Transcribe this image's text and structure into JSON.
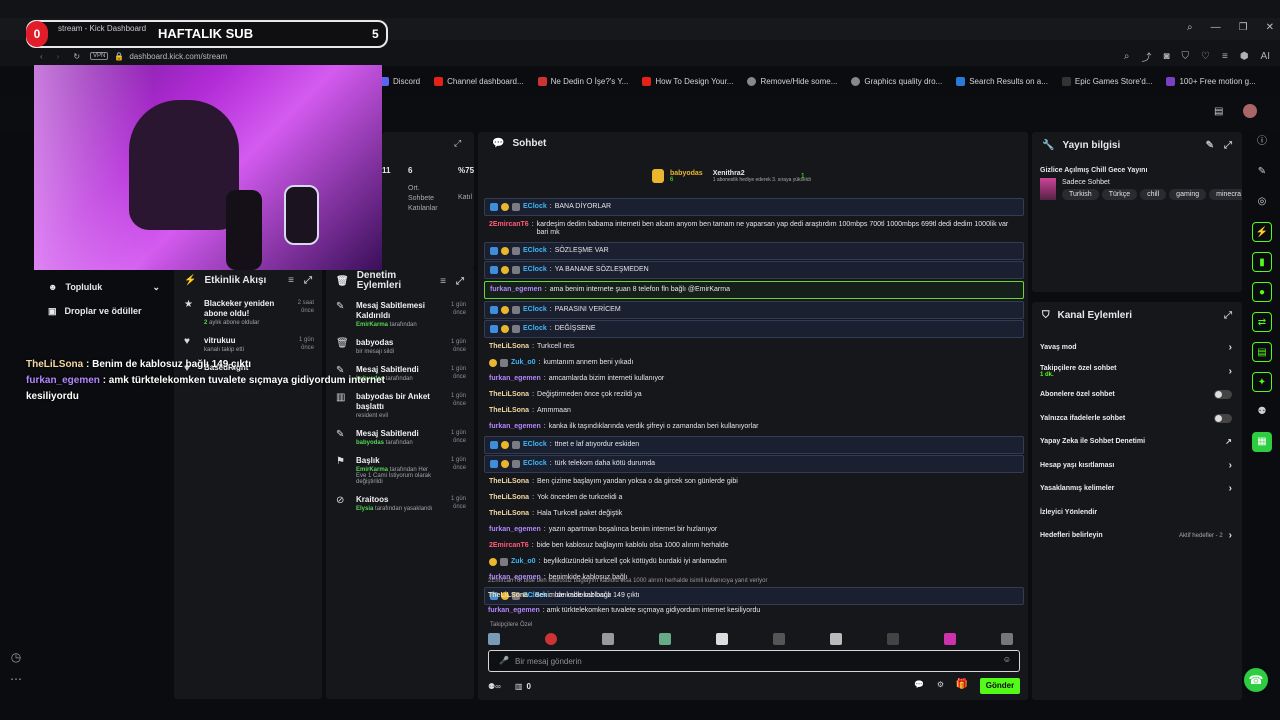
{
  "browser": {
    "tab_title": "stream - Kick Dashboard",
    "url": "dashboard.kick.com/stream",
    "vpn": "VPN",
    "bookmarks": [
      "Discord",
      "Channel dashboard...",
      "Ne Dedin O İşe?'s Y...",
      "How To Design Your...",
      "Remove/Hide some...",
      "Graphics quality dro...",
      "Search Results on a...",
      "Epic Games Store'd...",
      "100+ Free motion g..."
    ],
    "ai_label": "AI"
  },
  "overlay": {
    "sub_count": "0",
    "sub_title": "HAFTALIK SUB",
    "sub_goal": "5",
    "chat": [
      {
        "user": "TheLiLSona",
        "text": " : Benim de kablosuz bağlı 149 çıktı"
      },
      {
        "user": "furkan_egemen",
        "text": " : amk türktelekomken tuvalete sıçmaya gidiyordum internet kesiliyordu"
      }
    ]
  },
  "nav": {
    "items": [
      "Topluluk",
      "Droplar ve ödüller"
    ]
  },
  "stats": {
    "v1": "11",
    "v2": "6",
    "v2_label": "Ort. Sohbete Katılanlar",
    "v3": "%75",
    "v3_label": "Katıl"
  },
  "activity": {
    "title": "Etkinlik Akışı",
    "items": [
      {
        "title": "Blackeker yeniden abone oldu!",
        "sub_b": "2",
        "sub": " aylık abone oldular",
        "time": "2 saat önce",
        "icon": "star"
      },
      {
        "title": "vitrukuu",
        "sub": "kanalı takip etti",
        "time": "1 gün önce",
        "icon": "heart"
      },
      {
        "title": "BasedRight",
        "sub": "",
        "time": "",
        "icon": "heart"
      }
    ]
  },
  "moderation": {
    "title": "Denetim Eylemleri",
    "items": [
      {
        "title": "Mesaj Sabitlemesi Kaldırıldı",
        "sub_b": "EmirKarma",
        "sub": " tarafından",
        "time": "1 gün önce"
      },
      {
        "title": "babyodas",
        "sub": "bir mesajı sildi",
        "time": "1 gün önce"
      },
      {
        "title": "Mesaj Sabitlendi",
        "sub_b": "babyodas",
        "sub": " tarafından",
        "time": "1 gün önce"
      },
      {
        "title": "babyodas bir Anket başlattı",
        "sub": "resident evil",
        "time": "1 gün önce"
      },
      {
        "title": "Mesaj Sabitlendi",
        "sub_b": "babyodas",
        "sub": " tarafından",
        "time": "1 gün önce"
      },
      {
        "title": "Başlık",
        "sub_b": "EmirKarma",
        "sub": " tarafından Her Eve 1 Cami İstiyorum olarak değiştirildi",
        "time": "1 gün önce"
      },
      {
        "title": "Kraitoos",
        "sub_b": "Elysia",
        "sub": " tarafından yasaklandı",
        "time": "1 gün önce"
      }
    ]
  },
  "chat": {
    "title": "Sohbet",
    "pinned": {
      "user1": "babyodas",
      "user1_count": "6",
      "user2": "Xenithra2",
      "user2_count": "1",
      "note": "1 aboneslik hediye ederek 3. sıraya yükseldi"
    },
    "messages": [
      {
        "user": "EClock",
        "color": "#3fb6f5",
        "text": "BANA DİYORLAR",
        "style": "hl",
        "badges": [
          "mod",
          "sub",
          "vip"
        ]
      },
      {
        "user": "2EmircanT6",
        "color": "#ff5a7a",
        "text": "kardeşim dedim babama interneti ben alcam anyom ben tamam ne yaparsan yap dedi araştırdım 100mbps 700tl 1000mbps 699tl dedi dedim 1000lik var bari mk",
        "style": "",
        "badges": []
      },
      {
        "user": "EClock",
        "color": "#3fb6f5",
        "text": "SÖZLEŞME VAR",
        "style": "hl",
        "badges": [
          "mod",
          "sub",
          "vip"
        ]
      },
      {
        "user": "EClock",
        "color": "#3fb6f5",
        "text": "YA BANANE SÖZLEŞMEDEN",
        "style": "hl",
        "badges": [
          "mod",
          "sub",
          "vip"
        ]
      },
      {
        "user": "furkan_egemen",
        "color": "#b286ff",
        "text": "ama benim internete şuan 8 telefon fln bağlı @EmirKarma",
        "style": "mention",
        "badges": []
      },
      {
        "user": "EClock",
        "color": "#3fb6f5",
        "text": "PARASINI VERİCEM",
        "style": "hl",
        "badges": [
          "mod",
          "sub",
          "vip"
        ]
      },
      {
        "user": "EClock",
        "color": "#3fb6f5",
        "text": "DEĞİŞSENE",
        "style": "hl",
        "badges": [
          "mod",
          "sub",
          "vip"
        ]
      },
      {
        "user": "TheLiLSona",
        "color": "#f2d8a4",
        "text": "Turkcell reis",
        "style": "",
        "badges": []
      },
      {
        "user": "Zuk_o0",
        "color": "#3fb6f5",
        "text": "kumtanım annem beni yıkadı",
        "style": "",
        "badges": [
          "sub",
          "vip"
        ]
      },
      {
        "user": "furkan_egemen",
        "color": "#b286ff",
        "text": "amcamlarda bizim interneti kullanıyor",
        "style": "",
        "badges": []
      },
      {
        "user": "TheLiLSona",
        "color": "#f2d8a4",
        "text": "Değiştirmeden önce çok rezildi ya",
        "style": "",
        "badges": []
      },
      {
        "user": "TheLiLSona",
        "color": "#f2d8a4",
        "text": "Ammmaan",
        "style": "",
        "badges": []
      },
      {
        "user": "furkan_egemen",
        "color": "#b286ff",
        "text": "kanka ilk taşındıklarında verdik şifreyi o zamandan beri kullanıyorlar",
        "style": "",
        "badges": []
      },
      {
        "user": "EClock",
        "color": "#3fb6f5",
        "text": "ttnet e laf atıyordur eskiden",
        "style": "hl",
        "badges": [
          "mod",
          "sub",
          "vip"
        ]
      },
      {
        "user": "EClock",
        "color": "#3fb6f5",
        "text": "türk telekom daha kötü durumda",
        "style": "hl",
        "badges": [
          "mod",
          "sub",
          "vip"
        ]
      },
      {
        "user": "TheLiLSona",
        "color": "#f2d8a4",
        "text": "Ben çizime başlayım yandan yoksa o da gircek son günlerde gibi",
        "style": "",
        "badges": []
      },
      {
        "user": "TheLiLSona",
        "color": "#f2d8a4",
        "text": "Yok önceden de turkcelidi a",
        "style": "",
        "badges": []
      },
      {
        "user": "TheLiLSona",
        "color": "#f2d8a4",
        "text": "Hala Turkcell paket değiştik",
        "style": "",
        "badges": []
      },
      {
        "user": "furkan_egemen",
        "color": "#b286ff",
        "text": "yazın apartman boşalınca benim internet bir hızlanıyor",
        "style": "",
        "badges": []
      },
      {
        "user": "2EmircanT6",
        "color": "#ff5a7a",
        "text": "bide ben kablosuz bağlayım kablolu olsa 1000 alırım herhalde",
        "style": "",
        "badges": []
      },
      {
        "user": "Zuk_o0",
        "color": "#3fb6f5",
        "text": "beylikdüzündeki turkcell çok kötüydü burdaki iyi anlamadım",
        "style": "",
        "badges": [
          "sub",
          "vip"
        ]
      },
      {
        "user": "furkan_egemen",
        "color": "#b286ff",
        "text": "benimkide kablosuz bağlı",
        "style": "",
        "badges": []
      },
      {
        "user": "EClock",
        "color": "#3fb6f5",
        "text": "banimde kablosuz",
        "style": "hl",
        "badges": [
          "mod",
          "sub",
          "vip"
        ]
      }
    ],
    "reply_line": "2EmircanT6: bide ben kablosuz bağlayım kablolu olsa 1000 alırım herhalde isimli kullanıcıya yanıt veriyor",
    "tail": [
      {
        "user": "TheLiLSona",
        "color": "#f2d8a4",
        "text": "Benim de kablosuz bağlı 149 çıktı"
      },
      {
        "user": "furkan_egemen",
        "color": "#b286ff",
        "text": "amk türktelekomken tuvalete sıçmaya gidiyordum internet kesiliyordu"
      }
    ],
    "followers_label": "Takipçilere Özel",
    "input_placeholder": "Bir mesaj gönderin",
    "bottom_count": "0",
    "send_label": "Gönder"
  },
  "stream_info": {
    "title": "Yayın bilgisi",
    "stream_title": "Gizlice Açılmış Chill Gece Yayını",
    "category": "Sadece Sohbet",
    "tags": [
      "Turkish",
      "Türkçe",
      "chill",
      "gaming",
      "minecra"
    ]
  },
  "channel_actions": {
    "title": "Kanal Eylemleri",
    "rows": [
      {
        "label": "Yavaş mod",
        "control": "chevron",
        "sub": ""
      },
      {
        "label": "Takipçilere özel sohbet",
        "control": "chevron",
        "sub": "1 dk."
      },
      {
        "label": "Abonelere özel sohbet",
        "control": "toggle",
        "sub": ""
      },
      {
        "label": "Yalnızca ifadelerle sohbet",
        "control": "toggle",
        "sub": ""
      },
      {
        "label": "Yapay Zeka ile Sohbet Denetimi",
        "control": "external",
        "sub": ""
      },
      {
        "label": "Hesap yaşı kısıtlaması",
        "control": "chevron",
        "sub": ""
      },
      {
        "label": "Yasaklanmış kelimeler",
        "control": "chevron",
        "sub": ""
      },
      {
        "label": "İzleyici Yönlendir",
        "control": "none",
        "sub": ""
      },
      {
        "label": "Hedefleri belirleyin",
        "control": "chevron",
        "sub": "",
        "extra": "Aktif hedefler - 2"
      }
    ]
  },
  "colors": {
    "accent": "#53fc18",
    "mod": "#3e8edb",
    "sub": "#e9b62e",
    "live": "#e11d2a"
  }
}
